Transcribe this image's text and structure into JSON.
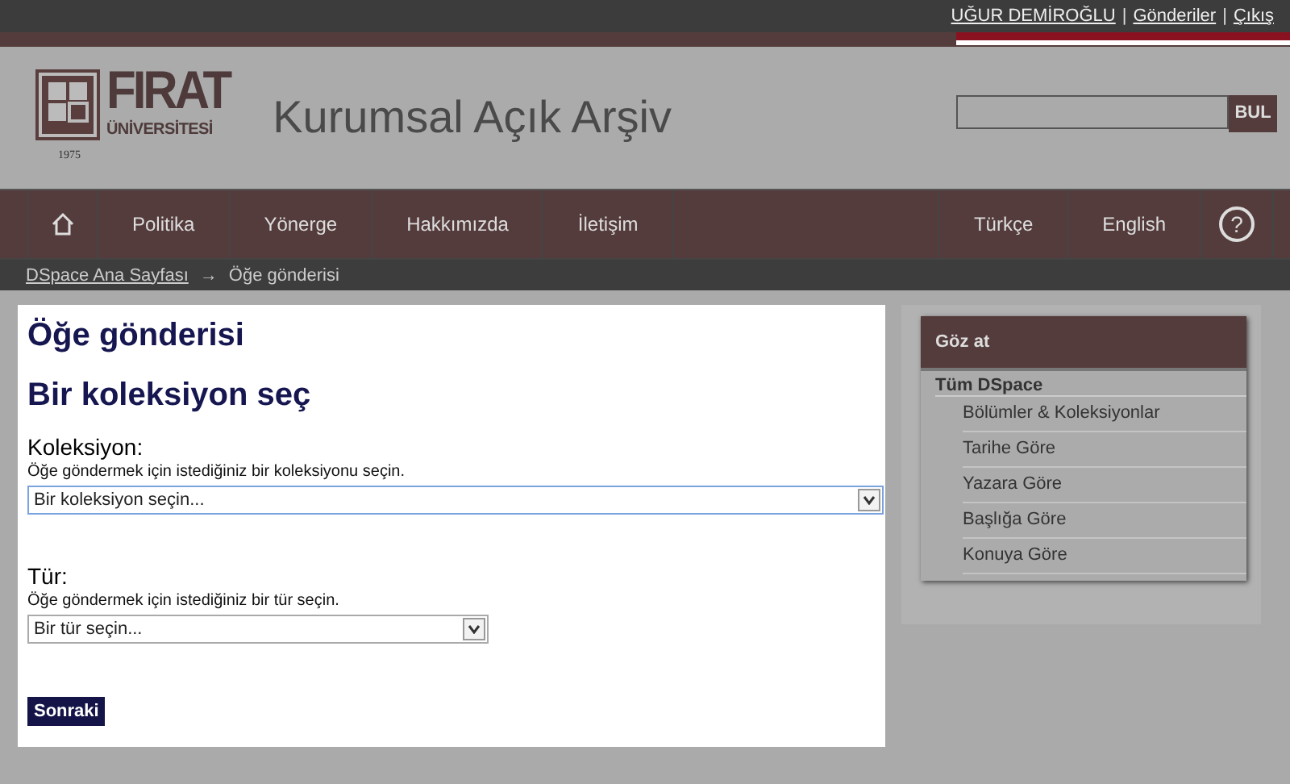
{
  "user_menu": [
    {
      "kind": "link",
      "text": "UĞUR DEMİROĞLU"
    },
    {
      "kind": "sep",
      "text": "|"
    },
    {
      "kind": "link",
      "text": "Gönderiler"
    },
    {
      "kind": "sep",
      "text": "|"
    },
    {
      "kind": "link",
      "text": "Çıkış"
    }
  ],
  "logo": {
    "name": "FIRAT",
    "sub": "ÜNİVERSİTESİ",
    "year": "1975"
  },
  "site_title": "Kurumsal Açık Arşiv",
  "search": {
    "button": "BUL"
  },
  "nav": [
    {
      "kind": "home"
    },
    {
      "kind": "link",
      "label": "Politika"
    },
    {
      "kind": "link",
      "label": "Yönerge"
    },
    {
      "kind": "link",
      "label": "Hakkımızda"
    },
    {
      "kind": "link",
      "label": "İletişim"
    },
    {
      "kind": "spacer"
    },
    {
      "kind": "link",
      "label": "Türkçe"
    },
    {
      "kind": "link",
      "label": "English"
    },
    {
      "kind": "help",
      "label": "?"
    }
  ],
  "breadcrumb": [
    {
      "kind": "link",
      "text": "DSpace Ana Sayfası"
    },
    {
      "kind": "sep",
      "text": "→"
    },
    {
      "kind": "current",
      "text": "Öğe gönderisi"
    }
  ],
  "page_title": "Öğe gönderisi",
  "section_title": "Bir koleksiyon seç",
  "fields": [
    {
      "label": "Koleksiyon:",
      "help": "Öğe göndermek için istediğiniz bir koleksiyonu seçin.",
      "value": "Bir koleksiyon seçin...",
      "focused": true,
      "wide": true
    },
    {
      "label": "Tür:",
      "help": "Öğe göndermek için istediğiniz bir tür seçin.",
      "value": "Bir tür seçin...",
      "focused": false,
      "wide": false
    }
  ],
  "submit": "Sonraki",
  "browse": {
    "title": "Göz at",
    "group": "Tüm DSpace",
    "items": [
      "Bölümler & Koleksiyonlar",
      "Tarihe Göre",
      "Yazara Göre",
      "Başlığa Göre",
      "Konuya Göre"
    ]
  }
}
